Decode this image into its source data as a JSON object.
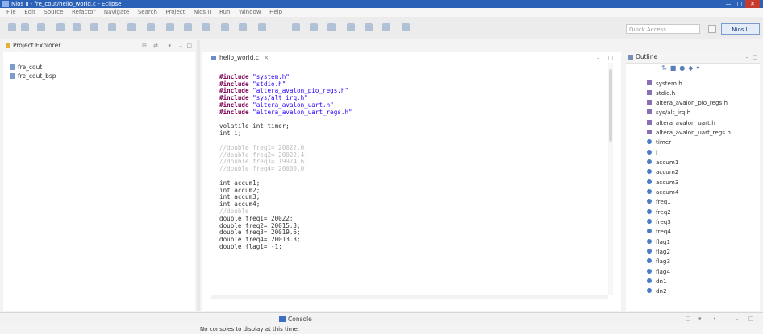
{
  "window": {
    "title": "Nios II - fre_cout/hello_world.c - Eclipse"
  },
  "menu": [
    "File",
    "Edit",
    "Source",
    "Refactor",
    "Navigate",
    "Search",
    "Project",
    "Nios II",
    "Run",
    "Window",
    "Help"
  ],
  "toolbar": {
    "quick_access_placeholder": "Quick Access",
    "perspective_label": "Nios II"
  },
  "project_explorer": {
    "title": "Project Explorer",
    "items": [
      "fre_cout",
      "fre_cout_bsp"
    ]
  },
  "editor": {
    "tab_label": "hello_world.c",
    "lines": [
      "#include \"system.h\"",
      "#include \"stdio.h\"",
      "#include \"altera_avalon_pio_regs.h\"",
      "#include \"sys/alt_irq.h\"",
      "#include \"altera_avalon_uart.h\"",
      "#include \"altera_avalon_uart_regs.h\"",
      "",
      "volatile int timer;",
      "int i;",
      "",
      "//double freq1= 20022.0;",
      "//double freq2= 20022.4;",
      "//double freq3= 19974.6;",
      "//double freq4= 20000.0;",
      "",
      "int accum1;",
      "int accum2;",
      "int accum3;",
      "int accum4;",
      "//double",
      "double freq1= 20022;",
      "double freq2= 20015.3;",
      "double freq3= 20019.6;",
      "double freq4= 20013.3;",
      "double flag1= -1;"
    ]
  },
  "outline": {
    "title": "Outline",
    "items": [
      {
        "label": "system.h",
        "kind": "include"
      },
      {
        "label": "stdio.h",
        "kind": "include"
      },
      {
        "label": "altera_avalon_pio_regs.h",
        "kind": "include"
      },
      {
        "label": "sys/alt_irq.h",
        "kind": "include"
      },
      {
        "label": "altera_avalon_uart.h",
        "kind": "include"
      },
      {
        "label": "altera_avalon_uart_regs.h",
        "kind": "include"
      },
      {
        "label": "timer",
        "kind": "var"
      },
      {
        "label": "i",
        "kind": "var"
      },
      {
        "label": "accum1",
        "kind": "var"
      },
      {
        "label": "accum2",
        "kind": "var"
      },
      {
        "label": "accum3",
        "kind": "var"
      },
      {
        "label": "accum4",
        "kind": "var"
      },
      {
        "label": "freq1",
        "kind": "var"
      },
      {
        "label": "freq2",
        "kind": "var"
      },
      {
        "label": "freq3",
        "kind": "var"
      },
      {
        "label": "freq4",
        "kind": "var"
      },
      {
        "label": "flag1",
        "kind": "var"
      },
      {
        "label": "flag2",
        "kind": "var"
      },
      {
        "label": "flag3",
        "kind": "var"
      },
      {
        "label": "flag4",
        "kind": "var"
      },
      {
        "label": "dn1",
        "kind": "var"
      },
      {
        "label": "dn2",
        "kind": "var"
      }
    ]
  },
  "console": {
    "tab_label": "Console",
    "message": "No consoles to display at this time."
  },
  "colors": {
    "title_bar": "#2b62b8",
    "keyword": "#7f0055",
    "string": "#2a00ff"
  }
}
